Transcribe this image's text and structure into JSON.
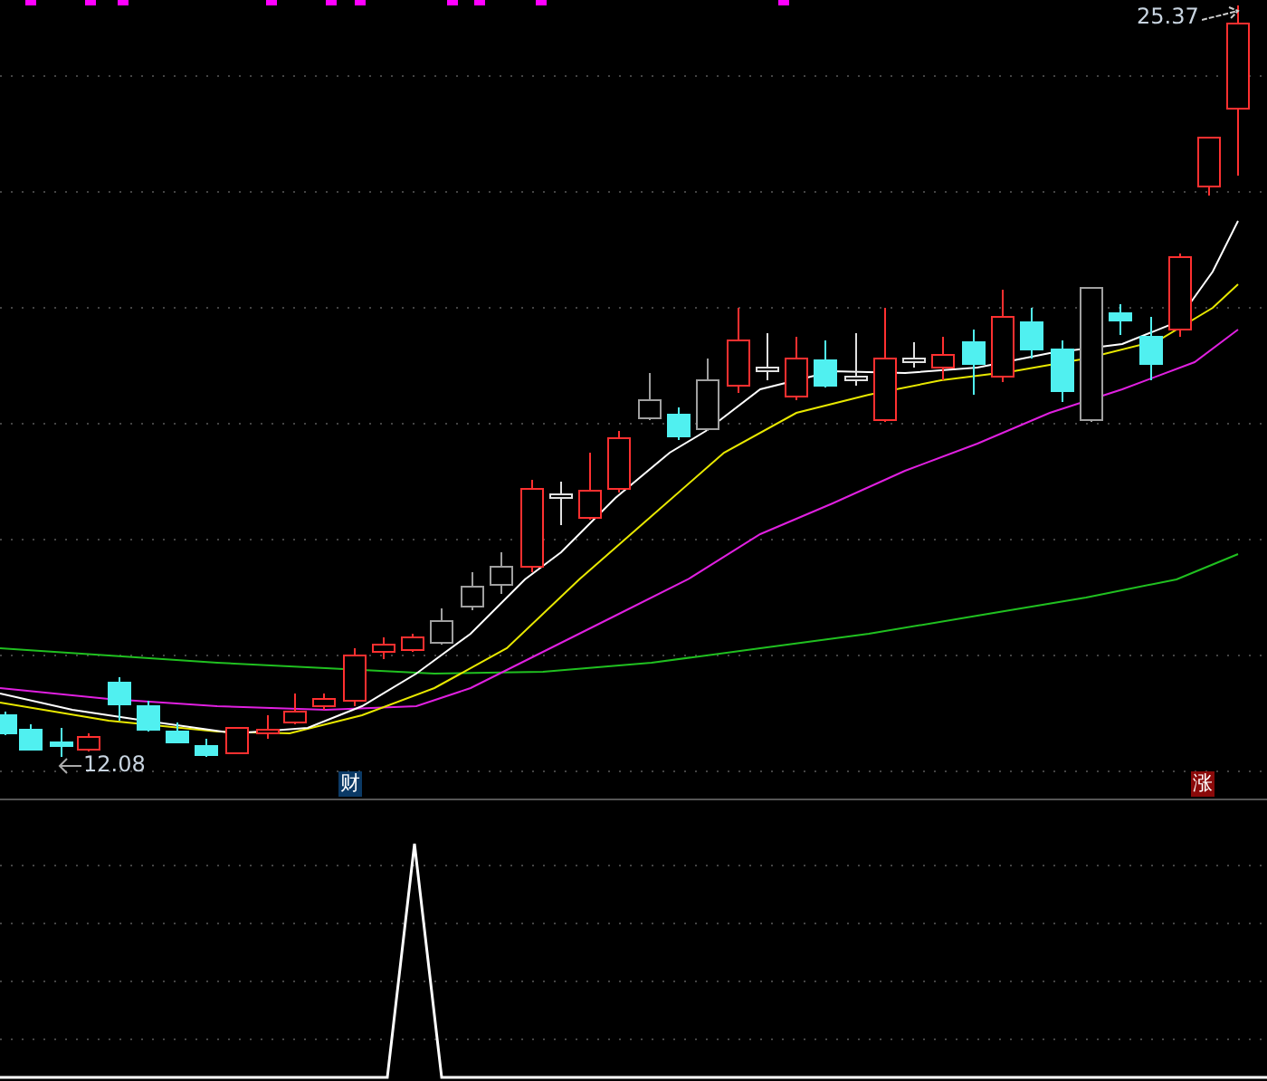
{
  "price_chart": {
    "high_label": "25.37",
    "low_label": "12.08",
    "markers": [
      {
        "text": "财",
        "color": "#0b3a66"
      },
      {
        "text": "涨",
        "color": "#8a0a0a"
      }
    ]
  }
}
